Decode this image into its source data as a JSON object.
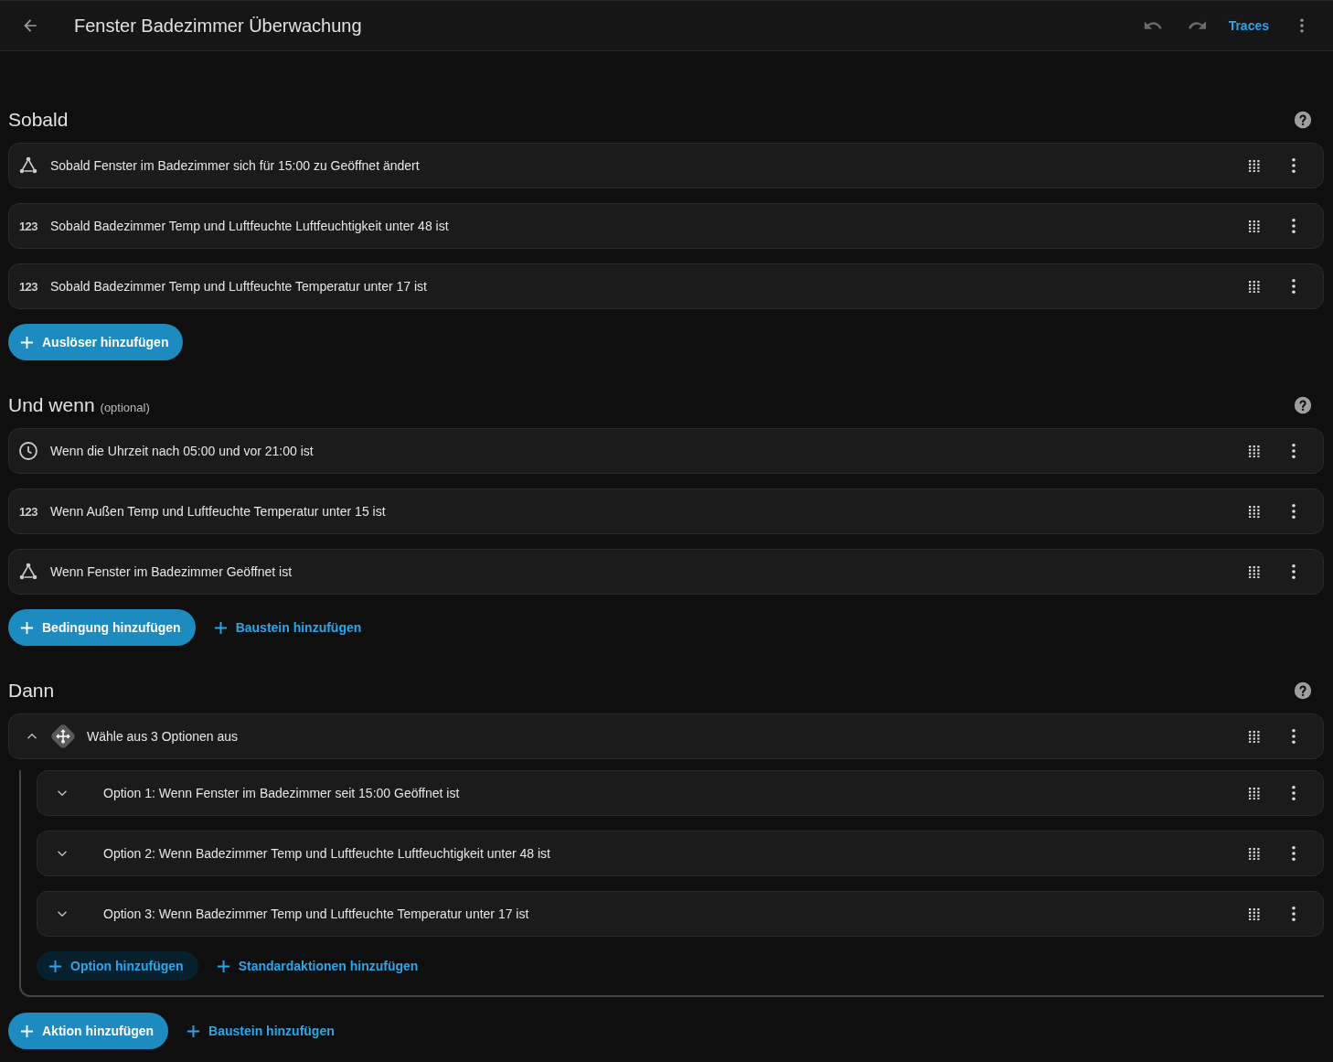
{
  "header": {
    "title": "Fenster Badezimmer Überwachung",
    "traces": "Traces"
  },
  "sections": [
    {
      "title": "Sobald",
      "items": [
        {
          "kind": "state",
          "text": "Sobald Fenster im Badezimmer sich für 15:00 zu Geöffnet ändert"
        },
        {
          "kind": "numeric",
          "icon_text": "123",
          "text": "Sobald Badezimmer Temp und Luftfeuchte Luftfeuchtigkeit unter 48 ist"
        },
        {
          "kind": "numeric",
          "icon_text": "123",
          "text": "Sobald Badezimmer Temp und Luftfeuchte Temperatur unter 17 ist"
        }
      ],
      "buttons": [
        {
          "kind": "filled",
          "label": "Auslöser hinzufügen"
        }
      ]
    },
    {
      "title": "Und wenn",
      "note": "(optional)",
      "items": [
        {
          "kind": "time",
          "text": "Wenn die Uhrzeit nach 05:00 und vor 21:00 ist"
        },
        {
          "kind": "numeric",
          "icon_text": "123",
          "text": "Wenn Außen Temp und Luftfeuchte Temperatur unter 15 ist"
        },
        {
          "kind": "state",
          "text": "Wenn Fenster im Badezimmer Geöffnet ist"
        }
      ],
      "buttons": [
        {
          "kind": "filled",
          "label": "Bedingung hinzufügen"
        },
        {
          "kind": "text",
          "label": "Baustein hinzufügen"
        }
      ]
    },
    {
      "title": "Dann",
      "items": [
        {
          "kind": "choose",
          "expanded": true,
          "text": "Wähle aus 3 Optionen aus",
          "options": [
            {
              "expanded": false,
              "text": "Option 1: Wenn Fenster im Badezimmer seit 15:00 Geöffnet ist"
            },
            {
              "expanded": false,
              "text": "Option 2: Wenn Badezimmer Temp und Luftfeuchte Luftfeuchtigkeit unter 48 ist"
            },
            {
              "expanded": false,
              "text": "Option 3: Wenn Badezimmer Temp und Luftfeuchte Temperatur unter 17 ist"
            }
          ],
          "buttons": [
            {
              "kind": "tonal",
              "label": "Option hinzufügen"
            },
            {
              "kind": "text",
              "label": "Standardaktionen hinzufügen"
            }
          ]
        }
      ],
      "buttons": [
        {
          "kind": "filled",
          "label": "Aktion hinzufügen"
        },
        {
          "kind": "text",
          "label": "Baustein hinzufügen"
        }
      ]
    }
  ]
}
